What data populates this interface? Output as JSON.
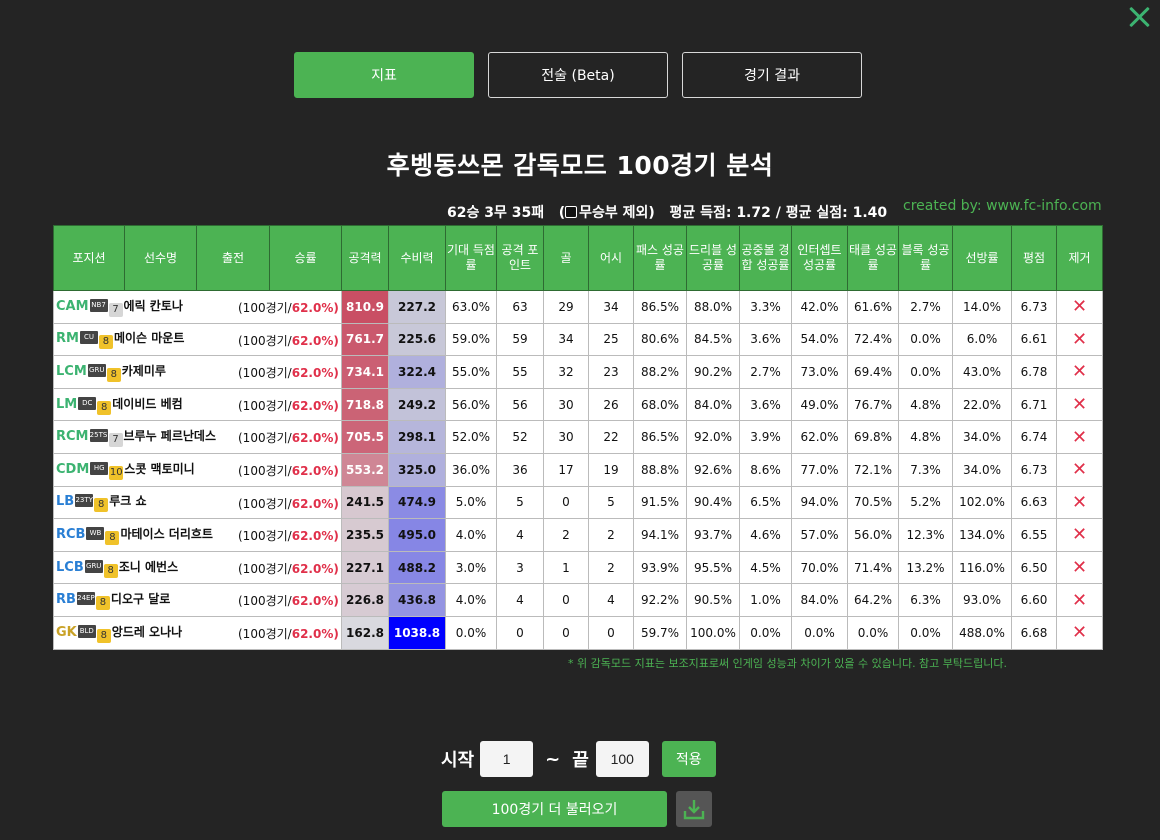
{
  "close_label": "✕",
  "tabs": [
    {
      "label": "지표",
      "active": true
    },
    {
      "label": "전술 (Beta)",
      "active": false
    },
    {
      "label": "경기 결과",
      "active": false
    }
  ],
  "title": "후벵동쓰몬 감독모드 100경기 분석",
  "summary": {
    "record": "62승 3무 35패",
    "excluded": "(",
    "excluded_label": "무승부 제외)",
    "avg": "평균 득점: 1.72 / 평균 실점: 1.40"
  },
  "credit": "created by: www.fc-info.com",
  "columns": [
    "포지션",
    "선수명",
    "출전",
    "승률",
    "공격력",
    "수비력",
    "기대 득점률",
    "공격 포인트",
    "골",
    "어시",
    "패스 성공률",
    "드리블 성공률",
    "공중볼 경합 성공률",
    "인터셉트 성공률",
    "태클 성공률",
    "블록 성공률",
    "선방률",
    "평점",
    "제거"
  ],
  "players": [
    {
      "pos": "CAM",
      "group": "fw",
      "season": "NB7",
      "level": "7",
      "tier": "silver",
      "name": "에릭 칸토나",
      "games_pre": "(100경기/",
      "rate": "62.0%)",
      "att": "810.9",
      "def": "227.2",
      "xg": "63.0%",
      "ap": "63",
      "goals": "29",
      "assists": "34",
      "pass": "86.5%",
      "dribble": "88.0%",
      "aerial": "3.3%",
      "intercept": "42.0%",
      "tackle": "61.6%",
      "block": "2.7%",
      "save": "14.0%",
      "rating": "6.73"
    },
    {
      "pos": "RM",
      "group": "fw",
      "season": "CU",
      "level": "8",
      "tier": "gold",
      "name": "메이슨 마운트",
      "games_pre": "(100경기/",
      "rate": "62.0%)",
      "att": "761.7",
      "def": "225.6",
      "xg": "59.0%",
      "ap": "59",
      "goals": "34",
      "assists": "25",
      "pass": "80.6%",
      "dribble": "84.5%",
      "aerial": "3.6%",
      "intercept": "54.0%",
      "tackle": "72.4%",
      "block": "0.0%",
      "save": "6.0%",
      "rating": "6.61"
    },
    {
      "pos": "LCM",
      "group": "fw",
      "season": "GRU",
      "level": "8",
      "tier": "gold",
      "name": "카제미루",
      "games_pre": "(100경기/",
      "rate": "62.0%)",
      "att": "734.1",
      "def": "322.4",
      "xg": "55.0%",
      "ap": "55",
      "goals": "32",
      "assists": "23",
      "pass": "88.2%",
      "dribble": "90.2%",
      "aerial": "2.7%",
      "intercept": "73.0%",
      "tackle": "69.4%",
      "block": "0.0%",
      "save": "43.0%",
      "rating": "6.78"
    },
    {
      "pos": "LM",
      "group": "fw",
      "season": "DC",
      "level": "8",
      "tier": "gold",
      "name": "데이비드 베컴",
      "games_pre": "(100경기/",
      "rate": "62.0%)",
      "att": "718.8",
      "def": "249.2",
      "xg": "56.0%",
      "ap": "56",
      "goals": "30",
      "assists": "26",
      "pass": "68.0%",
      "dribble": "84.0%",
      "aerial": "3.6%",
      "intercept": "49.0%",
      "tackle": "76.7%",
      "block": "4.8%",
      "save": "22.0%",
      "rating": "6.71"
    },
    {
      "pos": "RCM",
      "group": "fw",
      "season": "25TS",
      "level": "7",
      "tier": "silver",
      "name": "브루누 페르난데스",
      "games_pre": "(100경기/",
      "rate": "62.0%)",
      "att": "705.5",
      "def": "298.1",
      "xg": "52.0%",
      "ap": "52",
      "goals": "30",
      "assists": "22",
      "pass": "86.5%",
      "dribble": "92.0%",
      "aerial": "3.9%",
      "intercept": "62.0%",
      "tackle": "69.8%",
      "block": "4.8%",
      "save": "34.0%",
      "rating": "6.74"
    },
    {
      "pos": "CDM",
      "group": "fw",
      "season": "HG",
      "level": "10",
      "tier": "gold",
      "name": "스콧 맥토미니",
      "games_pre": "(100경기/",
      "rate": "62.0%)",
      "att": "553.2",
      "def": "325.0",
      "xg": "36.0%",
      "ap": "36",
      "goals": "17",
      "assists": "19",
      "pass": "88.8%",
      "dribble": "92.6%",
      "aerial": "8.6%",
      "intercept": "77.0%",
      "tackle": "72.1%",
      "block": "7.3%",
      "save": "34.0%",
      "rating": "6.73"
    },
    {
      "pos": "LB",
      "group": "df",
      "season": "23TY",
      "level": "8",
      "tier": "gold",
      "name": "루크 쇼",
      "games_pre": "(100경기/",
      "rate": "62.0%)",
      "att": "241.5",
      "def": "474.9",
      "xg": "5.0%",
      "ap": "5",
      "goals": "0",
      "assists": "5",
      "pass": "91.5%",
      "dribble": "90.4%",
      "aerial": "6.5%",
      "intercept": "94.0%",
      "tackle": "70.5%",
      "block": "5.2%",
      "save": "102.0%",
      "rating": "6.63"
    },
    {
      "pos": "RCB",
      "group": "df",
      "season": "WB",
      "level": "8",
      "tier": "gold",
      "name": "마테이스 더리흐트",
      "games_pre": "(100경기/",
      "rate": "62.0%)",
      "att": "235.5",
      "def": "495.0",
      "xg": "4.0%",
      "ap": "4",
      "goals": "2",
      "assists": "2",
      "pass": "94.1%",
      "dribble": "93.7%",
      "aerial": "4.6%",
      "intercept": "57.0%",
      "tackle": "56.0%",
      "block": "12.3%",
      "save": "134.0%",
      "rating": "6.55"
    },
    {
      "pos": "LCB",
      "group": "df",
      "season": "GRU",
      "level": "8",
      "tier": "gold",
      "name": "조니 에번스",
      "games_pre": "(100경기/",
      "rate": "62.0%)",
      "att": "227.1",
      "def": "488.2",
      "xg": "3.0%",
      "ap": "3",
      "goals": "1",
      "assists": "2",
      "pass": "93.9%",
      "dribble": "95.5%",
      "aerial": "4.5%",
      "intercept": "70.0%",
      "tackle": "71.4%",
      "block": "13.2%",
      "save": "116.0%",
      "rating": "6.50"
    },
    {
      "pos": "RB",
      "group": "df",
      "season": "24EP",
      "level": "8",
      "tier": "gold",
      "name": "디오구 달로",
      "games_pre": "(100경기/",
      "rate": "62.0%)",
      "att": "226.8",
      "def": "436.8",
      "xg": "4.0%",
      "ap": "4",
      "goals": "0",
      "assists": "4",
      "pass": "92.2%",
      "dribble": "90.5%",
      "aerial": "1.0%",
      "intercept": "84.0%",
      "tackle": "64.2%",
      "block": "6.3%",
      "save": "93.0%",
      "rating": "6.60"
    },
    {
      "pos": "GK",
      "group": "gk",
      "season": "BLD",
      "level": "8",
      "tier": "gold",
      "name": "앙드레 오나나",
      "games_pre": "(100경기/",
      "rate": "62.0%)",
      "att": "162.8",
      "def": "1038.8",
      "xg": "0.0%",
      "ap": "0",
      "goals": "0",
      "assists": "0",
      "pass": "59.7%",
      "dribble": "100.0%",
      "aerial": "0.0%",
      "intercept": "0.0%",
      "tackle": "0.0%",
      "block": "0.0%",
      "save": "488.0%",
      "rating": "6.68"
    }
  ],
  "note": "* 위 감독모드 지표는 보조지표로써 인게임 성능과 차이가 있을 수 있습니다. 참고 부탁드립니다.",
  "range": {
    "start_label": "시작",
    "start_value": "1",
    "sep": "~",
    "end_label": "끝",
    "end_value": "100",
    "apply_label": "적용"
  },
  "load_more_label": "100경기 더 불러오기",
  "remove_symbol": "✕",
  "colors": {
    "accent": "#4cb353",
    "rate": "#e0304a",
    "attack_scale": [
      "#ffffff",
      "#c94f64"
    ],
    "defense_scale": [
      "#ffffff",
      "#0000ff"
    ]
  }
}
